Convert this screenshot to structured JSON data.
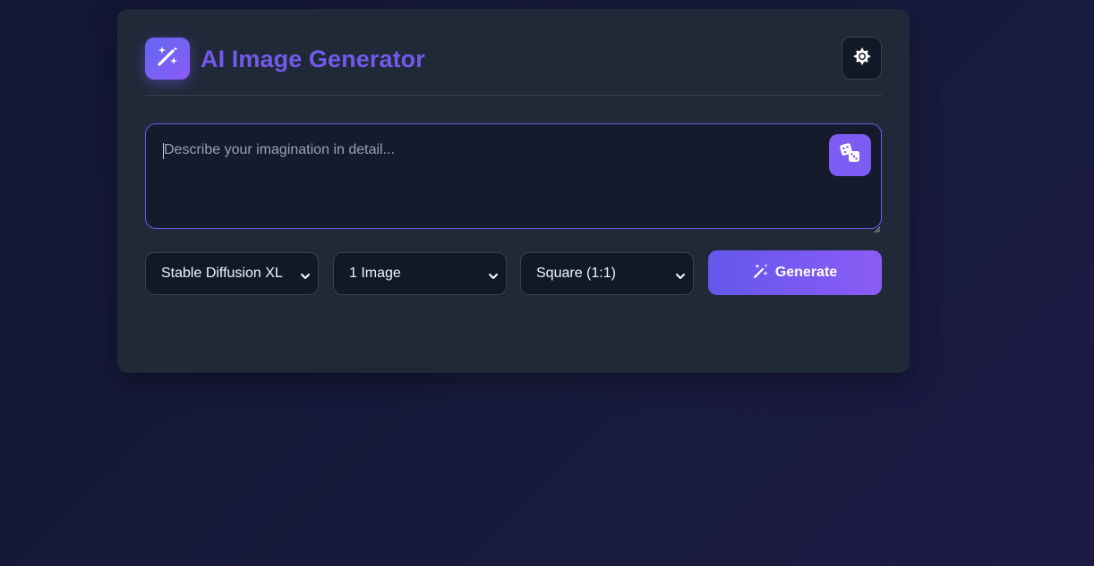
{
  "app": {
    "title": "AI Image Generator",
    "logo_icon": "magic-wand-sparkles-icon",
    "theme_toggle_icon": "sun-icon",
    "accent_color": "#7459ea"
  },
  "prompt": {
    "placeholder": "Describe your imagination in detail...",
    "value": "",
    "random_prompt_icon": "dice-icon"
  },
  "controls": {
    "model_select": {
      "selected": "Stable Diffusion XL"
    },
    "count_select": {
      "selected": "1 Image"
    },
    "ratio_select": {
      "selected": "Square (1:1)"
    },
    "generate_button": {
      "label": "Generate",
      "icon": "magic-wand-icon"
    }
  }
}
